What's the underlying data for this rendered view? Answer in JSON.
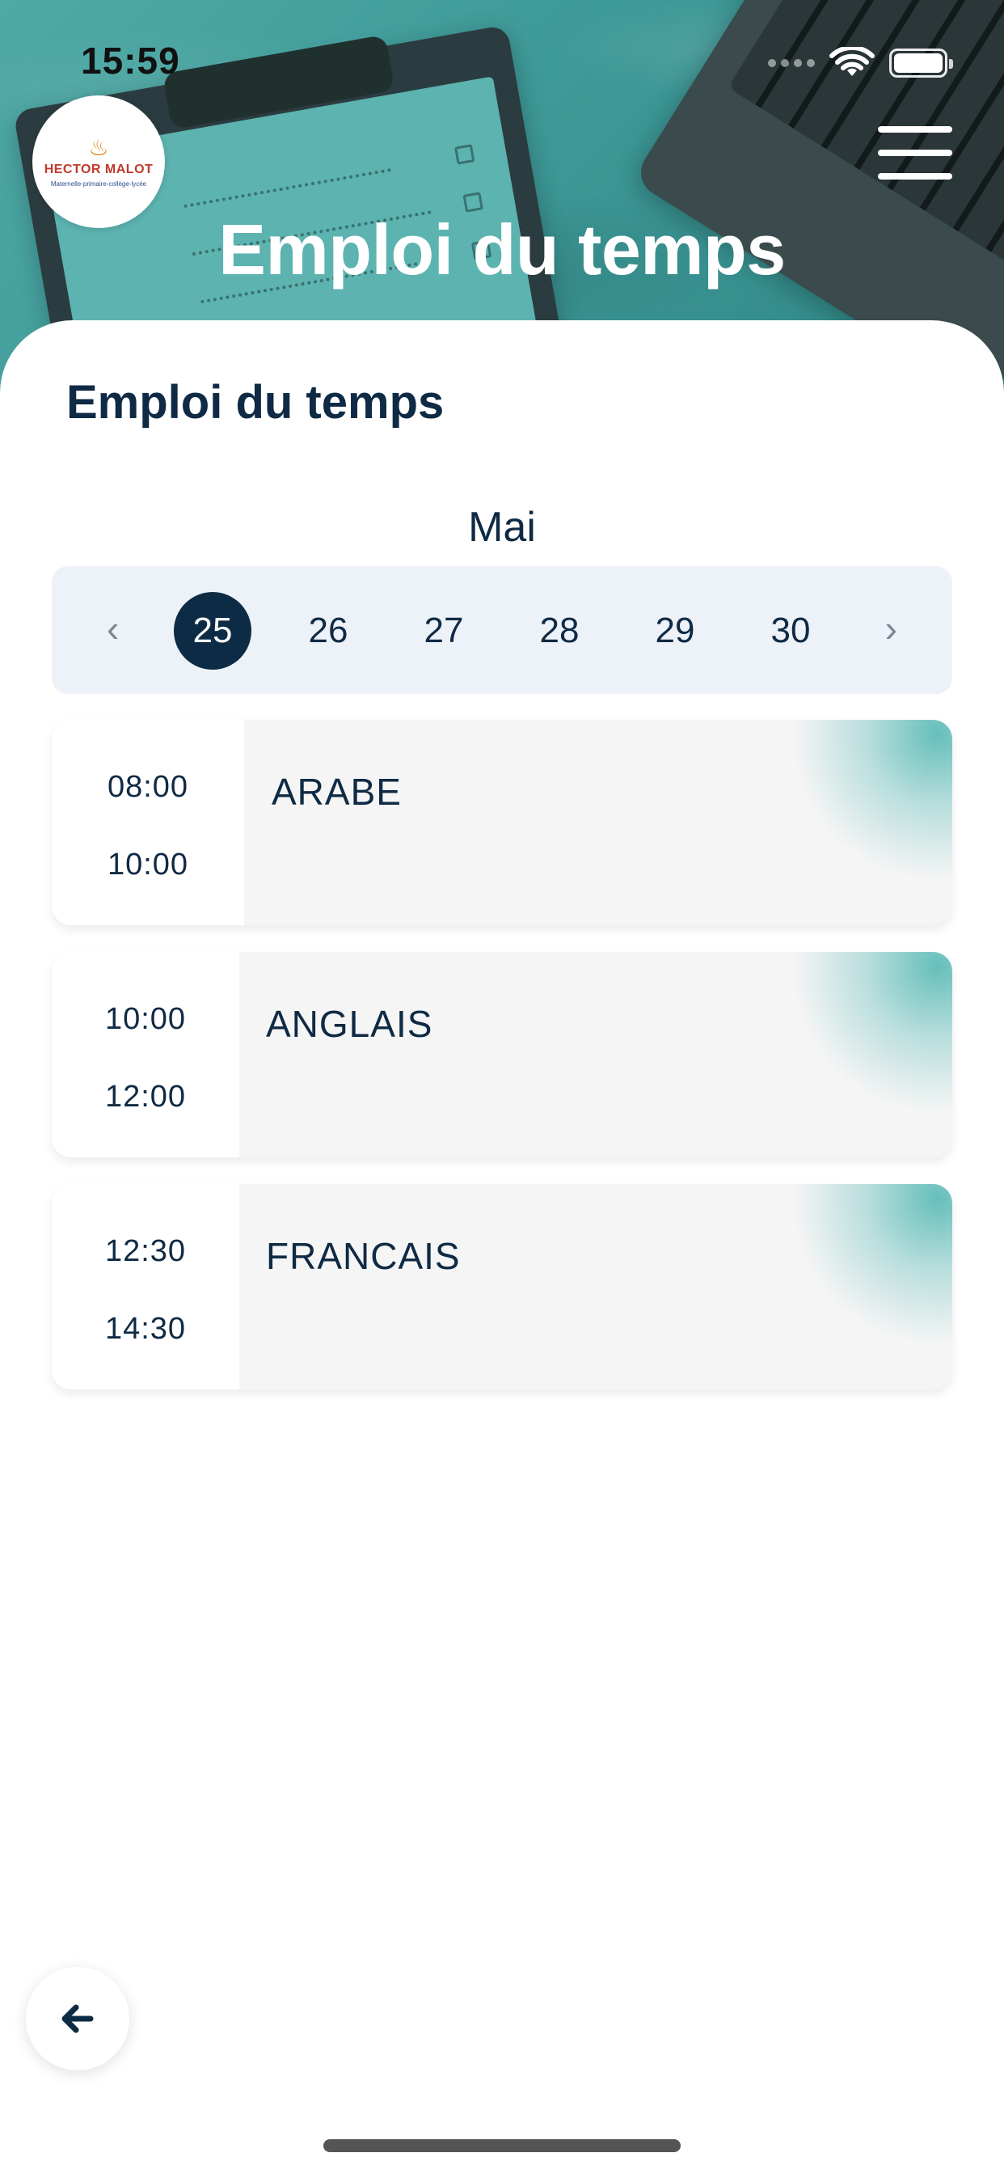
{
  "status_bar": {
    "time": "15:59"
  },
  "header": {
    "title": "Emploi du temps",
    "logo": {
      "name": "HECTOR MALOT",
      "subtitle": "Maternelle-primaire-collège-lycée"
    }
  },
  "page": {
    "section_title": "Emploi du temps",
    "month": "Mai",
    "dates": [
      {
        "day": "25",
        "selected": true
      },
      {
        "day": "26",
        "selected": false
      },
      {
        "day": "27",
        "selected": false
      },
      {
        "day": "28",
        "selected": false
      },
      {
        "day": "29",
        "selected": false
      },
      {
        "day": "30",
        "selected": false
      }
    ],
    "prev_icon": "‹",
    "next_icon": "›"
  },
  "lessons": [
    {
      "start": "08:00",
      "end": "10:00",
      "subject": "ARABE"
    },
    {
      "start": "10:00",
      "end": "12:00",
      "subject": "ANGLAIS"
    },
    {
      "start": "12:30",
      "end": "14:30",
      "subject": "FRANCAIS"
    }
  ],
  "icons": {
    "menu": "hamburger-menu-icon",
    "back": "arrow-left-icon",
    "wifi": "wifi-icon",
    "battery": "battery-icon"
  },
  "colors": {
    "header_teal": "#4fa9a6",
    "primary_navy": "#0d2b45",
    "date_strip_bg": "#edf1f8",
    "card_bg": "#f5f5f5",
    "card_glow": "#4cb5b0"
  }
}
